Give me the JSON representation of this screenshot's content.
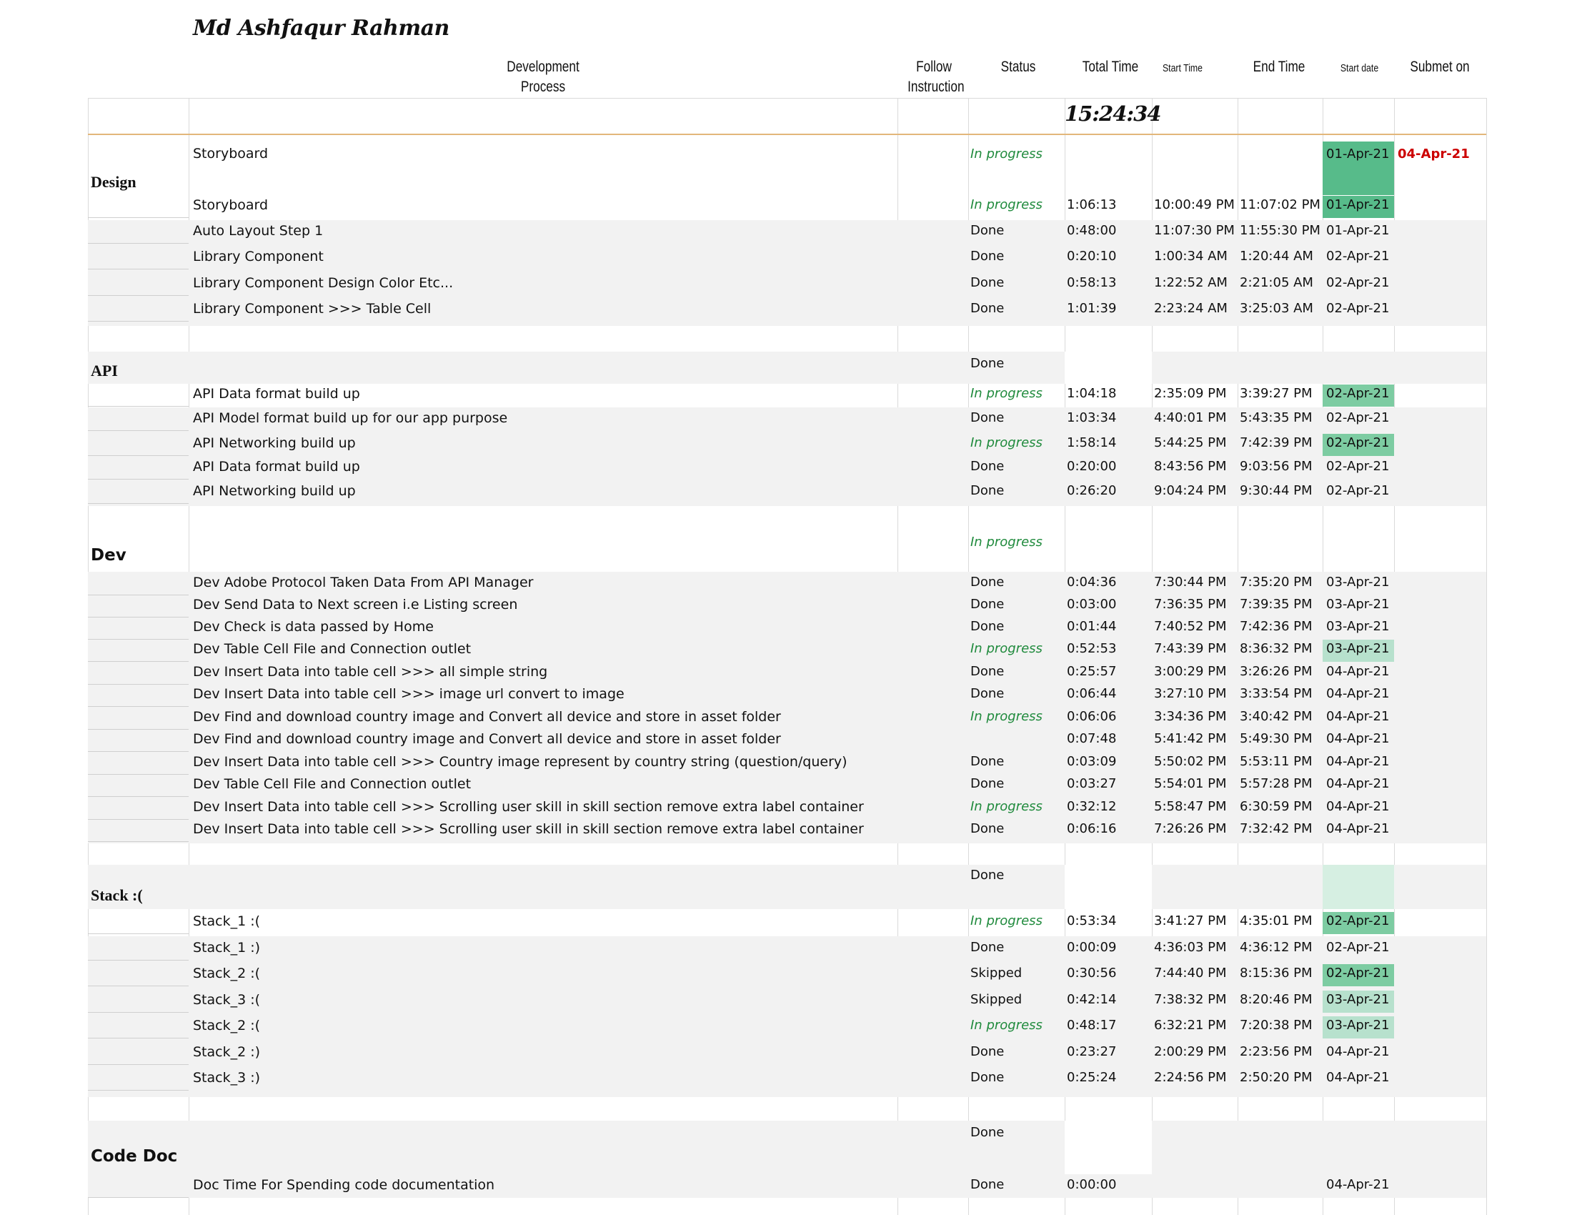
{
  "author": "Md Ashfaqur Rahman",
  "headers": {
    "process": "Development Process",
    "follow": "Follow Instruction",
    "status": "Status",
    "total_time": "Total Time",
    "start_time": "Start Time",
    "end_time": "End Time",
    "start_date": "Start date",
    "submit_on": "Submet on"
  },
  "total_time_value": "15:24:34",
  "colors": {
    "in_progress": "#1f8a3c",
    "highlight_dark": "#57bb8a",
    "highlight_light": "#b7e1cd",
    "red": "#cc0000"
  },
  "sections": {
    "design": "Design",
    "api": "API",
    "dev": "Dev",
    "stack": "Stack :(",
    "code_doc": "Code Doc"
  },
  "design_header": {
    "task": "Storyboard",
    "status": "In progress",
    "start_date": "01-Apr-21",
    "submit_on": "04-Apr-21"
  },
  "api_header_status": "Done",
  "dev_header_status": "In progress",
  "stack_header_status": "Done",
  "codedoc_header_status": "Done",
  "rows": [
    {
      "task": "Storyboard",
      "status": "In progress",
      "total": "1:06:13",
      "start": "10:00:49 PM",
      "end": "11:07:02 PM",
      "date": "01-Apr-21"
    },
    {
      "task": "Auto Layout Step 1",
      "status": "Done",
      "total": "0:48:00",
      "start": "11:07:30 PM",
      "end": "11:55:30 PM",
      "date": "01-Apr-21"
    },
    {
      "task": "Library Component",
      "status": "Done",
      "total": "0:20:10",
      "start": "1:00:34 AM",
      "end": "1:20:44 AM",
      "date": "02-Apr-21"
    },
    {
      "task": "Library Component Design Color Etc...",
      "status": "Done",
      "total": "0:58:13",
      "start": "1:22:52 AM",
      "end": "2:21:05 AM",
      "date": "02-Apr-21"
    },
    {
      "task": "Library Component >>> Table Cell",
      "status": "Done",
      "total": "1:01:39",
      "start": "2:23:24 AM",
      "end": "3:25:03 AM",
      "date": "02-Apr-21"
    },
    {
      "task": "API Data format build up",
      "status": "In progress",
      "total": "1:04:18",
      "start": "2:35:09 PM",
      "end": "3:39:27 PM",
      "date": "02-Apr-21"
    },
    {
      "task": "API Model format build up for our app purpose",
      "status": "Done",
      "total": "1:03:34",
      "start": "4:40:01 PM",
      "end": "5:43:35 PM",
      "date": "02-Apr-21"
    },
    {
      "task": "API Networking build up",
      "status": "In progress",
      "total": "1:58:14",
      "start": "5:44:25 PM",
      "end": "7:42:39 PM",
      "date": "02-Apr-21"
    },
    {
      "task": "API Data format build up",
      "status": "Done",
      "total": "0:20:00",
      "start": "8:43:56 PM",
      "end": "9:03:56 PM",
      "date": "02-Apr-21"
    },
    {
      "task": "API Networking build up",
      "status": "Done",
      "total": "0:26:20",
      "start": "9:04:24 PM",
      "end": "9:30:44 PM",
      "date": "02-Apr-21"
    },
    {
      "task": "Dev Adobe Protocol Taken Data From API Manager",
      "status": "Done",
      "total": "0:04:36",
      "start": "7:30:44 PM",
      "end": "7:35:20 PM",
      "date": "03-Apr-21"
    },
    {
      "task": "Dev Send Data to Next screen i.e Listing screen",
      "status": "Done",
      "total": "0:03:00",
      "start": "7:36:35 PM",
      "end": "7:39:35 PM",
      "date": "03-Apr-21"
    },
    {
      "task": "Dev Check is data passed by Home",
      "status": "Done",
      "total": "0:01:44",
      "start": "7:40:52 PM",
      "end": "7:42:36 PM",
      "date": "03-Apr-21"
    },
    {
      "task": "Dev Table Cell File and Connection outlet",
      "status": "In progress",
      "total": "0:52:53",
      "start": "7:43:39 PM",
      "end": "8:36:32 PM",
      "date": "03-Apr-21"
    },
    {
      "task": "Dev Insert Data into table cell  >>> all simple string",
      "status": "Done",
      "total": "0:25:57",
      "start": "3:00:29 PM",
      "end": "3:26:26 PM",
      "date": "04-Apr-21"
    },
    {
      "task": "Dev Insert Data into table cell  >>> image url convert to image",
      "status": "Done",
      "total": "0:06:44",
      "start": "3:27:10 PM",
      "end": "3:33:54 PM",
      "date": "04-Apr-21"
    },
    {
      "task": "Dev Find and download country image and Convert all device and store in asset folder",
      "status": "In progress",
      "total": "0:06:06",
      "start": "3:34:36 PM",
      "end": "3:40:42 PM",
      "date": "04-Apr-21"
    },
    {
      "task": "Dev Find and download country image and Convert all device and store in asset folder",
      "status": "",
      "total": "0:07:48",
      "start": "5:41:42 PM",
      "end": "5:49:30 PM",
      "date": "04-Apr-21"
    },
    {
      "task": "Dev Insert Data into table cell  >>> Country image represent by country string (question/query)",
      "status": "Done",
      "total": "0:03:09",
      "start": "5:50:02 PM",
      "end": "5:53:11 PM",
      "date": "04-Apr-21"
    },
    {
      "task": "Dev Table Cell File and Connection outlet",
      "status": "Done",
      "total": "0:03:27",
      "start": "5:54:01 PM",
      "end": "5:57:28 PM",
      "date": "04-Apr-21"
    },
    {
      "task": "Dev Insert Data into table cell  >>> Scrolling user skill in skill section remove extra label container",
      "status": "In progress",
      "total": "0:32:12",
      "start": "5:58:47 PM",
      "end": "6:30:59 PM",
      "date": "04-Apr-21"
    },
    {
      "task": "Dev Insert Data into table cell  >>> Scrolling user skill in skill section remove extra label container",
      "status": "Done",
      "total": "0:06:16",
      "start": "7:26:26 PM",
      "end": "7:32:42 PM",
      "date": "04-Apr-21"
    },
    {
      "task": "Stack_1 :(",
      "status": "In progress",
      "total": "0:53:34",
      "start": "3:41:27 PM",
      "end": "4:35:01 PM",
      "date": "02-Apr-21"
    },
    {
      "task": "Stack_1 :)",
      "status": "Done",
      "total": "0:00:09",
      "start": "4:36:03 PM",
      "end": "4:36:12 PM",
      "date": "02-Apr-21"
    },
    {
      "task": "Stack_2 :(",
      "status": "Skipped",
      "total": "0:30:56",
      "start": "7:44:40 PM",
      "end": "8:15:36 PM",
      "date": "02-Apr-21"
    },
    {
      "task": "Stack_3 :(",
      "status": "Skipped",
      "total": "0:42:14",
      "start": "7:38:32 PM",
      "end": "8:20:46 PM",
      "date": "03-Apr-21"
    },
    {
      "task": "Stack_2 :(",
      "status": "In progress",
      "total": "0:48:17",
      "start": "6:32:21 PM",
      "end": "7:20:38 PM",
      "date": "03-Apr-21"
    },
    {
      "task": "Stack_2 :)",
      "status": "Done",
      "total": "0:23:27",
      "start": "2:00:29 PM",
      "end": "2:23:56 PM",
      "date": "04-Apr-21"
    },
    {
      "task": "Stack_3 :)",
      "status": "Done",
      "total": "0:25:24",
      "start": "2:24:56 PM",
      "end": "2:50:20 PM",
      "date": "04-Apr-21"
    },
    {
      "task": "Doc Time For Spending code documentation",
      "status": "Done",
      "total": "0:00:00",
      "start": "",
      "end": "",
      "date": "04-Apr-21"
    }
  ]
}
